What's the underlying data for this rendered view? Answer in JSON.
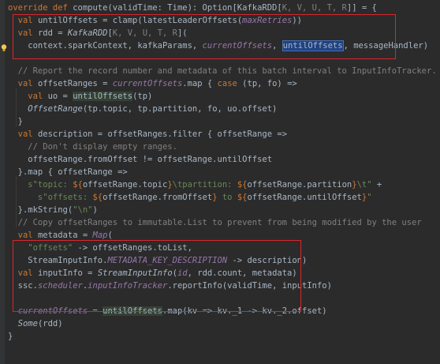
{
  "code_lines": [
    {
      "segs": [
        [
          "k",
          "override def "
        ],
        [
          "t",
          "compute(validTime: Time): Option[KafkaRDD["
        ],
        [
          "tp",
          "K, V, U, T, R"
        ],
        [
          "t",
          "]] = {"
        ]
      ]
    },
    {
      "segs": [
        [
          "t",
          "  "
        ],
        [
          "k",
          "val "
        ],
        [
          "t",
          "untilOffsets = clamp(latestLeaderOffsets("
        ],
        [
          "i",
          "maxRetries"
        ],
        [
          "t",
          "))"
        ]
      ]
    },
    {
      "segs": [
        [
          "t",
          "  "
        ],
        [
          "k",
          "val "
        ],
        [
          "t",
          "rdd = "
        ],
        [
          "fn",
          "KafkaRDD"
        ],
        [
          "t",
          "["
        ],
        [
          "tp",
          "K, V, U, T, R"
        ],
        [
          "t",
          "]("
        ]
      ]
    },
    {
      "segs": [
        [
          "t",
          "    context.sparkContext, kafkaParams, "
        ],
        [
          "i",
          "currentOffsets"
        ],
        [
          "t",
          ", "
        ],
        [
          "hlb",
          "untilOffsets"
        ],
        [
          "t",
          ", messageHandler)"
        ]
      ]
    },
    {
      "segs": []
    },
    {
      "segs": [
        [
          "c",
          "  // Report the record number and metadata of this batch interval to InputInfoTracker."
        ]
      ]
    },
    {
      "segs": [
        [
          "t",
          "  "
        ],
        [
          "k",
          "val "
        ],
        [
          "t",
          "offsetRanges = "
        ],
        [
          "i",
          "currentOffsets"
        ],
        [
          "t",
          ".map { "
        ],
        [
          "k",
          "case "
        ],
        [
          "t",
          "(tp, fo) =>"
        ]
      ]
    },
    {
      "segs": [
        [
          "t",
          "    "
        ],
        [
          "k",
          "val "
        ],
        [
          "t",
          "uo = "
        ],
        [
          "hlg",
          "untilOffsets"
        ],
        [
          "t",
          "(tp)"
        ]
      ]
    },
    {
      "segs": [
        [
          "t",
          "    "
        ],
        [
          "fn",
          "OffsetRange"
        ],
        [
          "t",
          "(tp.topic, tp.partition, fo, uo.offset)"
        ]
      ]
    },
    {
      "segs": [
        [
          "t",
          "  }"
        ]
      ]
    },
    {
      "segs": [
        [
          "t",
          "  "
        ],
        [
          "k",
          "val "
        ],
        [
          "t",
          "description = offsetRanges.filter { offsetRange =>"
        ]
      ]
    },
    {
      "segs": [
        [
          "c",
          "    // Don't display empty ranges."
        ]
      ]
    },
    {
      "segs": [
        [
          "t",
          "    offsetRange.fromOffset != offsetRange.untilOffset"
        ]
      ]
    },
    {
      "segs": [
        [
          "t",
          "  }.map { offsetRange =>"
        ]
      ]
    },
    {
      "segs": [
        [
          "s",
          "    s\"topic: "
        ],
        [
          "e",
          "${"
        ],
        [
          "t",
          "offsetRange.topic"
        ],
        [
          "e",
          "}"
        ],
        [
          "s",
          "\\tpartition: "
        ],
        [
          "e",
          "${"
        ],
        [
          "t",
          "offsetRange.partition"
        ],
        [
          "e",
          "}"
        ],
        [
          "s",
          "\\t\""
        ],
        [
          "t",
          " +"
        ]
      ]
    },
    {
      "segs": [
        [
          "s",
          "      s\"offsets: "
        ],
        [
          "e",
          "${"
        ],
        [
          "t",
          "offsetRange.fromOffset"
        ],
        [
          "e",
          "}"
        ],
        [
          "s",
          " to "
        ],
        [
          "e",
          "${"
        ],
        [
          "t",
          "offsetRange.untilOffset"
        ],
        [
          "e",
          "}"
        ],
        [
          "s",
          "\""
        ]
      ]
    },
    {
      "segs": [
        [
          "t",
          "  }.mkString("
        ],
        [
          "s",
          "\"\\n\""
        ],
        [
          "t",
          ")"
        ]
      ]
    },
    {
      "segs": [
        [
          "c",
          "  // Copy offsetRanges to immutable.List to prevent from being modified by the user"
        ]
      ]
    },
    {
      "segs": [
        [
          "t",
          "  "
        ],
        [
          "k",
          "val "
        ],
        [
          "t",
          "metadata = "
        ],
        [
          "i",
          "Map"
        ],
        [
          "t",
          "("
        ]
      ]
    },
    {
      "segs": [
        [
          "s",
          "    \"offsets\" "
        ],
        [
          "t",
          "-> offsetRanges.toList,"
        ]
      ]
    },
    {
      "segs": [
        [
          "t",
          "    StreamInputInfo."
        ],
        [
          "i",
          "METADATA_KEY_DESCRIPTION"
        ],
        [
          "t",
          " -> description)"
        ]
      ]
    },
    {
      "segs": [
        [
          "t",
          "  "
        ],
        [
          "k",
          "val "
        ],
        [
          "t",
          "inputInfo = "
        ],
        [
          "fn",
          "StreamInputInfo"
        ],
        [
          "t",
          "("
        ],
        [
          "i",
          "id"
        ],
        [
          "t",
          ", rdd.count, metadata)"
        ]
      ]
    },
    {
      "segs": [
        [
          "t",
          "  ssc."
        ],
        [
          "i",
          "scheduler"
        ],
        [
          "t",
          "."
        ],
        [
          "i",
          "inputInfoTracker"
        ],
        [
          "t",
          ".reportInfo(validTime, inputInfo)"
        ]
      ]
    },
    {
      "segs": []
    },
    {
      "segs": [
        [
          "t",
          "  "
        ],
        [
          "i",
          "currentOffsets"
        ],
        [
          "t",
          " = "
        ],
        [
          "hlg",
          "untilOffsets"
        ],
        [
          "t",
          ".map(kv => kv._1 -> kv._2.offset)"
        ]
      ]
    },
    {
      "segs": [
        [
          "t",
          "  "
        ],
        [
          "fn",
          "Some"
        ],
        [
          "t",
          "(rdd)"
        ]
      ]
    },
    {
      "segs": [
        [
          "t",
          "}"
        ]
      ]
    }
  ],
  "colors": {
    "background": "#2b2b2b",
    "keyword": "#cc7832",
    "text": "#a9b7c6",
    "field": "#9876aa",
    "comment": "#808080",
    "string": "#6a8759",
    "highlight_box": "#d9262c"
  },
  "icons": {
    "gutter": "lightbulb-icon"
  }
}
